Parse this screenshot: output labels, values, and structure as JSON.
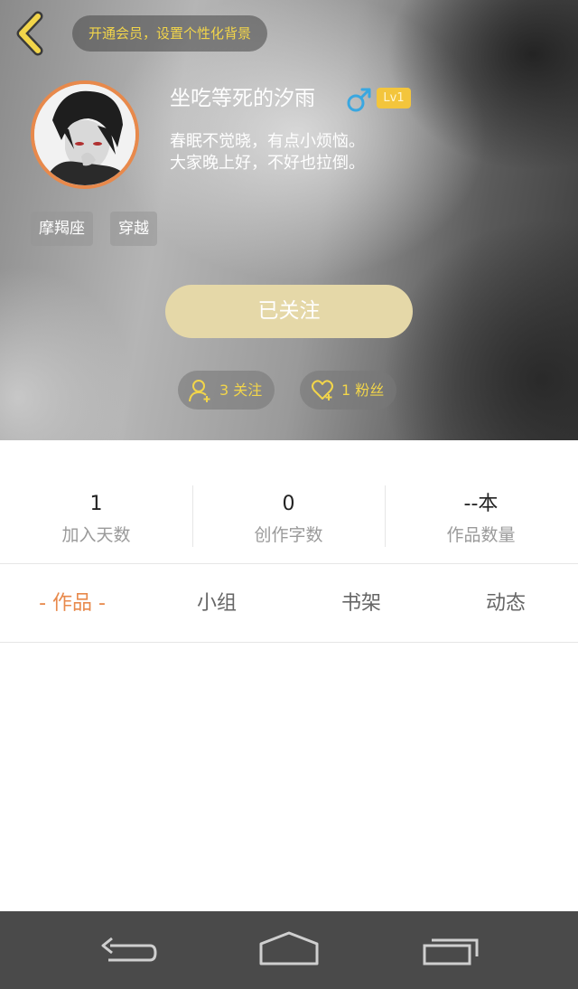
{
  "header": {
    "vip_prompt": "开通会员，设置个性化背景",
    "username": "坐吃等死的汐雨",
    "gender_icon": "male-icon",
    "level": "Lv1",
    "bio_line1": "春眠不觉晓，有点小烦恼。",
    "bio_line2": "大家晚上好，不好也拉倒。",
    "tags": [
      "摩羯座",
      "穿越"
    ],
    "follow_button_label": "已关注",
    "following_label": "3 关注",
    "followers_label": "1 粉丝"
  },
  "stats": [
    {
      "value": "1",
      "label": "加入天数"
    },
    {
      "value": "0",
      "label": "创作字数"
    },
    {
      "value": "--本",
      "label": "作品数量"
    }
  ],
  "tabs": [
    "- 作品 -",
    "小组",
    "书架",
    "动态"
  ],
  "active_tab": 0,
  "colors": {
    "accent": "#e8894b",
    "vip_text": "#f2d54a",
    "follow_button": "#e5d8a8",
    "level_badge": "#f3c53c",
    "male_icon": "#3aa7e0",
    "navbar": "#4a4a4a"
  },
  "navbar": {
    "icons": [
      "back-icon",
      "home-icon",
      "recent-apps-icon"
    ]
  }
}
